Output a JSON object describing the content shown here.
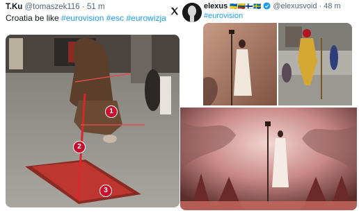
{
  "left_tweet": {
    "display_name": "T.Ku",
    "handle": "@tomaszek116",
    "separator": "·",
    "age": "51 m",
    "text_prefix": "Croatia be like ",
    "hashtags": [
      "#eurovision",
      "#esc",
      "#eurowizja"
    ],
    "markers": [
      "1",
      "2",
      "3"
    ],
    "platform_icon": "x-logo-icon"
  },
  "right_tweet": {
    "display_name": "elexus",
    "handle": "@elexusvoid",
    "separator": "·",
    "age": "48 m",
    "hashtag": "#eurovision",
    "flags": [
      "🇺🇦",
      "🇱🇹",
      "🇫🇮",
      "🇸🇪"
    ],
    "verified_icon": "verified-badge-icon"
  },
  "colors": {
    "hashtag": "#1d9bf0",
    "marker": "#c8102e",
    "meta_text": "#536471"
  }
}
